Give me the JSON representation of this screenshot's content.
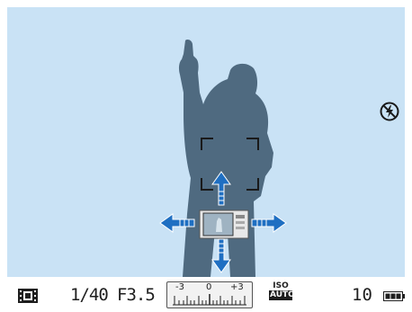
{
  "status_bar": {
    "mode_icon": "panorama-film-icon",
    "shutter_speed": "1/40",
    "aperture": "F3.5",
    "ev_scale": {
      "minus_label": "-3",
      "zero_label": "0",
      "plus_label": "+3"
    },
    "iso": {
      "top": "ISO",
      "bottom": "AUTO"
    },
    "shots_remaining": "10",
    "battery_icon": "battery-full-icon"
  },
  "viewfinder": {
    "flash_icon": "flash-off-icon",
    "pan_arrows": [
      "up",
      "down",
      "left",
      "right"
    ],
    "colors": {
      "sky": "#c9e2f5",
      "silhouette": "#4f6a80",
      "arrow": "#1f6fc2"
    }
  }
}
